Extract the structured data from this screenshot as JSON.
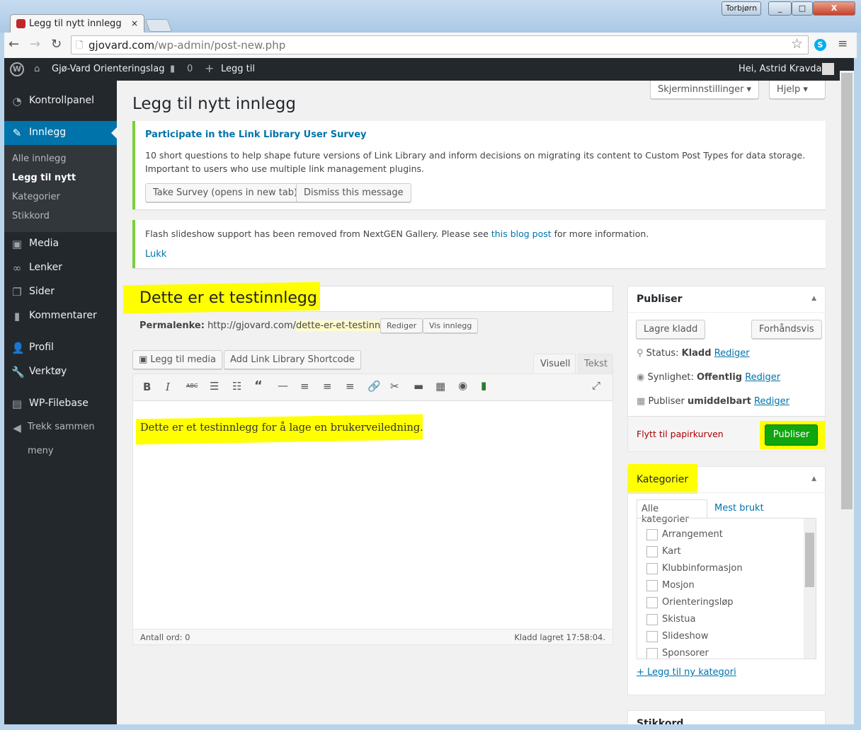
{
  "browser": {
    "tab_title": "Legg til nytt innlegg",
    "user_badge": "Torbjørn",
    "url_domain": "gjovard.com",
    "url_path": "/wp-admin/post-new.php"
  },
  "adminbar": {
    "site": "Gjø-Vard Orienteringslag",
    "comments": "0",
    "new": "Legg til",
    "greeting": "Hei, Astrid Kravdal"
  },
  "sidebar": {
    "items": [
      "Kontrollpanel",
      "Innlegg",
      "Media",
      "Lenker",
      "Sider",
      "Kommentarer",
      "Profil",
      "Verktøy",
      "WP-Filebase",
      "Trekk sammen",
      "meny"
    ],
    "sub": [
      "Alle innlegg",
      "Legg til nytt",
      "Kategorier",
      "Stikkord"
    ]
  },
  "header": {
    "title": "Legg til nytt innlegg",
    "screen_options": "Skjerminnstillinger",
    "help": "Hjelp"
  },
  "notice1": {
    "title": "Participate in the Link Library User Survey",
    "text1": "10 short questions to help shape future versions of Link Library and inform decisions on migrating its content to Custom Post Types for data storage.",
    "text2": "Important to users who use multiple link management plugins.",
    "btn1": "Take Survey (opens in new tab)",
    "btn2": "Dismiss this message"
  },
  "notice2": {
    "text_a": "Flash slideshow support has been removed from NextGEN Gallery. Please see ",
    "link": "this blog post",
    "text_b": " for more information.",
    "close": "Lukk"
  },
  "editor": {
    "title_value": "Dette er et testinnlegg",
    "permalink_label": "Permalenke:",
    "permalink_base": "http://gjovard.com/",
    "permalink_slug": "dette-er-et-testinnlegg",
    "edit": "Rediger",
    "view": "Vis innlegg",
    "add_media": "Legg til media",
    "add_link": "Add Link Library Shortcode",
    "tab_visual": "Visuell",
    "tab_text": "Tekst",
    "content": "Dette er et testinnlegg for å lage en brukerveiledning.",
    "word_count": "Antall ord: 0",
    "saved": "Kladd lagret 17:58:04."
  },
  "publish": {
    "title": "Publiser",
    "save_draft": "Lagre kladd",
    "preview": "Forhåndsvis",
    "status_label": "Status:",
    "status": "Kladd",
    "visibility_label": "Synlighet:",
    "visibility": "Offentlig",
    "publish_label": "Publiser",
    "publish_when": "umiddelbart",
    "edit": "Rediger",
    "trash": "Flytt til papirkurven",
    "publish_btn": "Publiser",
    "accent": "#0fa60f"
  },
  "categories": {
    "title": "Kategorier",
    "tab_all": "Alle kategorier",
    "tab_popular": "Mest brukt",
    "items": [
      "Arrangement",
      "Kart",
      "Klubbinformasjon",
      "Mosjon",
      "Orienteringsløp",
      "Skistua",
      "Slideshow",
      "Sponsorer"
    ],
    "add": "+ Legg til ny kategori"
  },
  "tags": {
    "title": "Stikkord"
  }
}
